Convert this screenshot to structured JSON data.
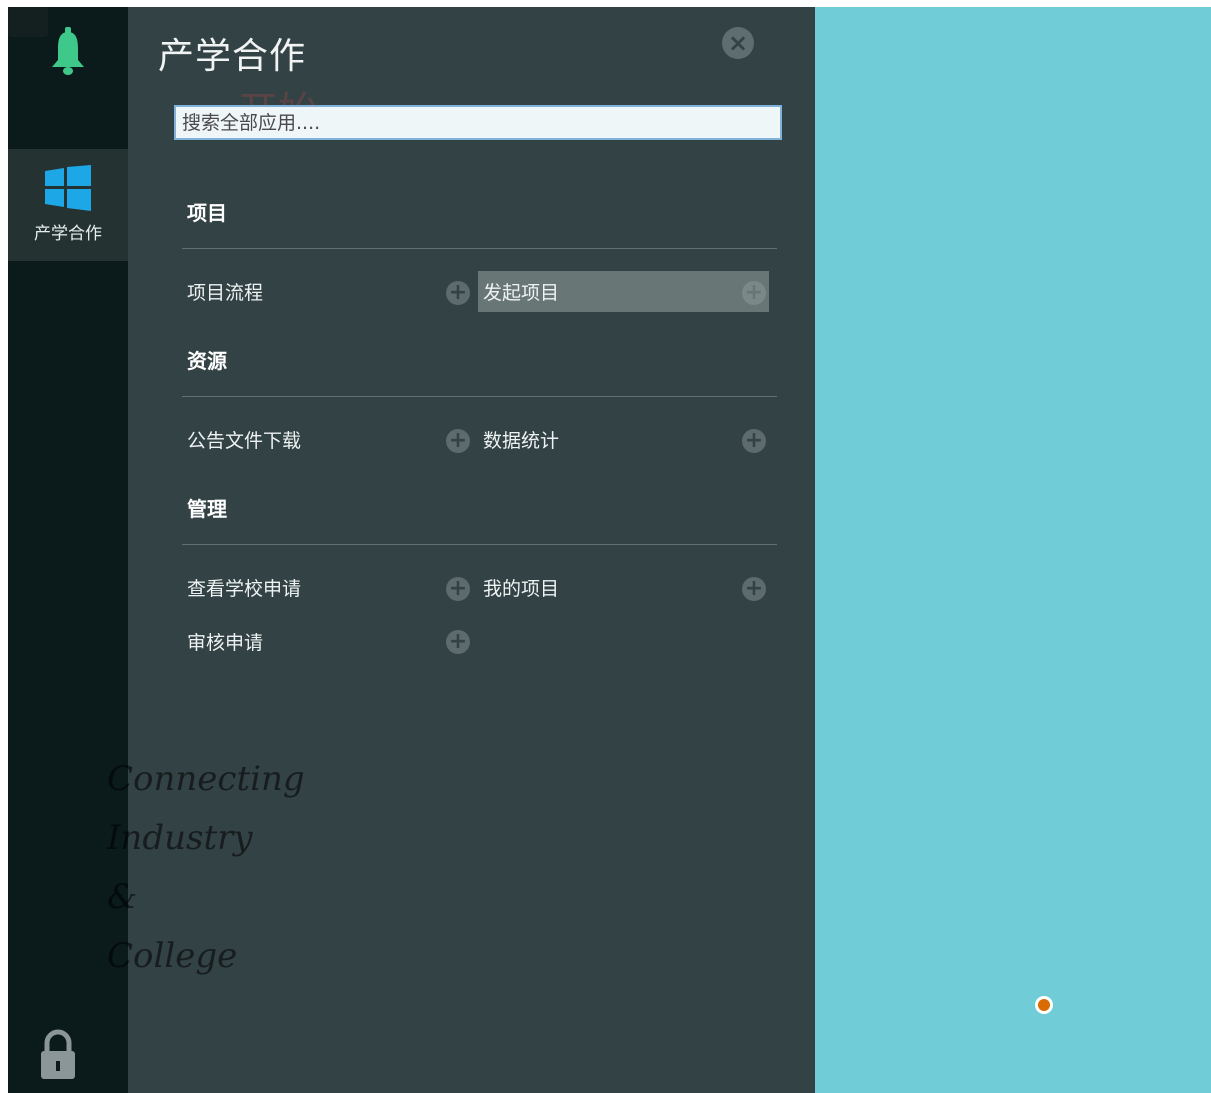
{
  "rail": {
    "top_icon": "bell-icon",
    "active_item": {
      "icon": "windows-icon",
      "label": "产学合作"
    },
    "bottom_icon": "lock-icon"
  },
  "panel": {
    "title": "产学合作",
    "ghost_text": "开始",
    "close_icon": "close-icon",
    "search": {
      "placeholder": "搜索全部应用....",
      "value": ""
    },
    "sections": [
      {
        "title": "项目",
        "items": [
          "项目流程",
          "发起项目"
        ]
      },
      {
        "title": "资源",
        "items": [
          "公告文件下载",
          "数据统计"
        ]
      },
      {
        "title": "管理",
        "items": [
          "查看学校申请",
          "我的项目",
          "审核申请"
        ]
      }
    ],
    "highlighted_item": "发起项目",
    "add_icon": "plus-circle-icon"
  },
  "slogan": [
    "Connecting",
    "Industry",
    "&",
    "College"
  ],
  "colors": {
    "rail_bg": "#0b1a1b",
    "panel_bg": "#334244",
    "desktop_bg": "#70cdd7",
    "accent_green": "#3ec98a",
    "accent_blue": "#1ea7e6",
    "highlight_bg": "#697676",
    "dot": "#d96b00"
  }
}
